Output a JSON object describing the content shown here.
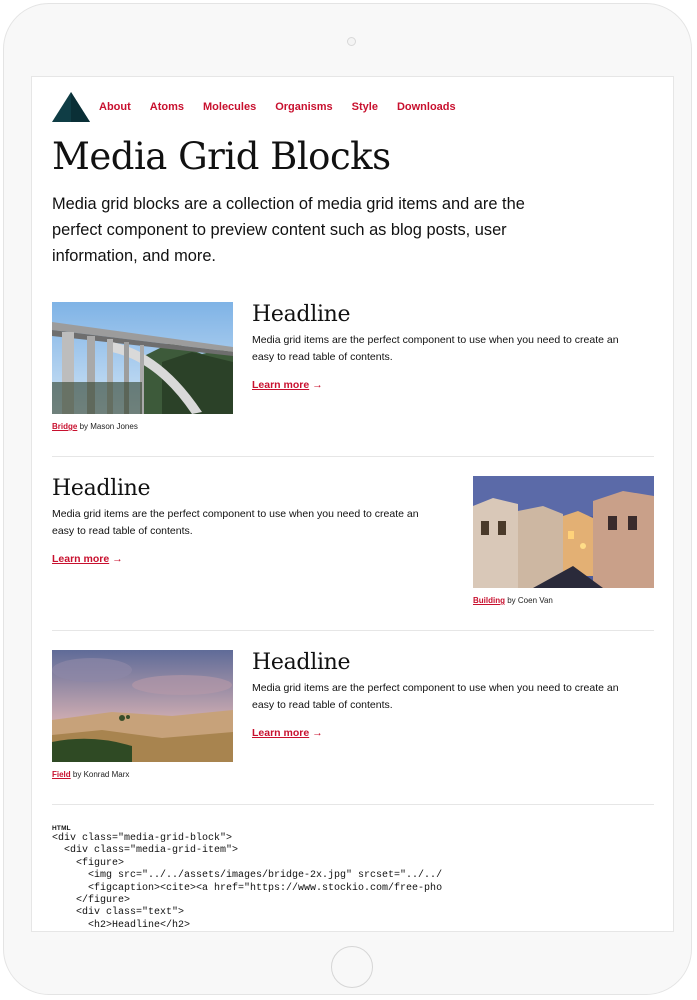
{
  "nav": {
    "items": [
      {
        "label": "About"
      },
      {
        "label": "Atoms"
      },
      {
        "label": "Molecules"
      },
      {
        "label": "Organisms"
      },
      {
        "label": "Style"
      },
      {
        "label": "Downloads"
      }
    ]
  },
  "page": {
    "title": "Media Grid Blocks",
    "intro": "Media grid blocks are a collection of media grid items and are the perfect component to preview content such as blog posts, user information, and more."
  },
  "items": [
    {
      "headline": "Headline",
      "body": "Media grid items are the perfect component to use when you need to create an easy to read table of contents.",
      "link": "Learn more",
      "arrow": "→",
      "caption_link": "Bridge",
      "caption_rest": " by Mason Jones",
      "image_subject": "bridge-photo"
    },
    {
      "headline": "Headline",
      "body": "Media grid items are the perfect component to use when you need to create an easy to read table of contents.",
      "link": "Learn more",
      "arrow": "→",
      "caption_link": "Building",
      "caption_rest": " by Coen Van",
      "image_subject": "street-night-photo"
    },
    {
      "headline": "Headline",
      "body": "Media grid items are the perfect component to use when you need to create an easy to read table of contents.",
      "link": "Learn more",
      "arrow": "→",
      "caption_link": "Field",
      "caption_rest": " by Konrad Marx",
      "image_subject": "field-landscape-photo"
    }
  ],
  "code": {
    "label": "HTML",
    "source": "<div class=\"media-grid-block\">\n  <div class=\"media-grid-item\">\n    <figure>\n      <img src=\"../../assets/images/bridge-2x.jpg\" srcset=\"../../\n      <figcaption><cite><a href=\"https://www.stockio.com/free-pho\n    </figure>\n    <div class=\"text\">\n      <h2>Headline</h2>"
  },
  "colors": {
    "accent": "#c8102e",
    "logo": "#0f3d45"
  }
}
